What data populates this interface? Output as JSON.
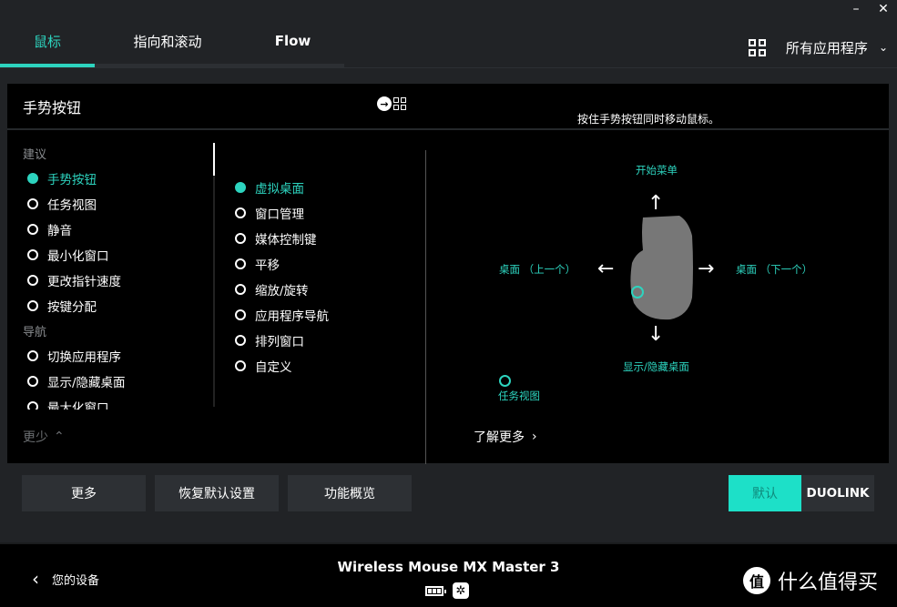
{
  "window": {
    "minimize": "–",
    "close": "✕"
  },
  "tabs": [
    {
      "label": "鼠标",
      "active": true
    },
    {
      "label": "指向和滚动",
      "active": false
    },
    {
      "label": "Flow",
      "active": false
    }
  ],
  "app_selector": {
    "label": "所有应用程序",
    "icon": "apps-grid-icon"
  },
  "panel": {
    "title": "手势按钮",
    "hint": "按住手势按钮同时移动鼠标。"
  },
  "col1": {
    "sections": [
      {
        "heading": "建议",
        "items": [
          {
            "label": "手势按钮",
            "selected": true
          },
          {
            "label": "任务视图",
            "selected": false
          },
          {
            "label": "静音",
            "selected": false
          },
          {
            "label": "最小化窗口",
            "selected": false
          },
          {
            "label": "更改指针速度",
            "selected": false
          },
          {
            "label": "按键分配",
            "selected": false
          }
        ]
      },
      {
        "heading": "导航",
        "items": [
          {
            "label": "切换应用程序",
            "selected": false
          },
          {
            "label": "显示/隐藏桌面",
            "selected": false
          },
          {
            "label": "最大化窗口",
            "selected": false
          }
        ]
      }
    ],
    "less_label": "更少"
  },
  "col2": {
    "items": [
      {
        "label": "虚拟桌面",
        "selected": true
      },
      {
        "label": "窗口管理",
        "selected": false
      },
      {
        "label": "媒体控制键",
        "selected": false
      },
      {
        "label": "平移",
        "selected": false
      },
      {
        "label": "缩放/旋转",
        "selected": false
      },
      {
        "label": "应用程序导航",
        "selected": false
      },
      {
        "label": "排列窗口",
        "selected": false
      },
      {
        "label": "自定义",
        "selected": false
      }
    ]
  },
  "diagram": {
    "up": "开始菜单",
    "left": "桌面 （上一个）",
    "right": "桌面 （下一个）",
    "down": "显示/隐藏桌面",
    "click": "任务视图",
    "learn_more": "了解更多"
  },
  "buttons": {
    "more": "更多",
    "reset": "恢复默认设置",
    "overview": "功能概览",
    "default": "默认",
    "duolink": "DUOLINK"
  },
  "footer": {
    "back_label": "您的设备",
    "device_name": "Wireless Mouse MX Master 3",
    "battery_level": "3/3 bars",
    "watermark_badge": "值",
    "watermark_text": "什么值得买"
  },
  "colors": {
    "accent": "#2dd4bf",
    "panel": "#000000",
    "background": "#212326",
    "button": "#2d3034"
  }
}
